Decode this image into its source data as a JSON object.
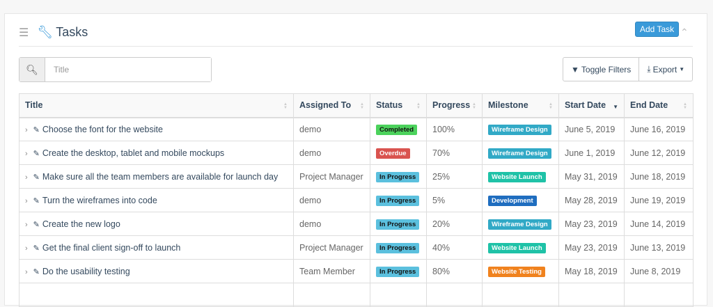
{
  "header": {
    "title": "Tasks",
    "add_label": "Add Task"
  },
  "search": {
    "placeholder": "Title"
  },
  "toolbar": {
    "toggle_filters": "Toggle Filters",
    "export": "Export"
  },
  "columns": [
    "Title",
    "Assigned To",
    "Status",
    "Progress",
    "Milestone",
    "Start Date",
    "End Date"
  ],
  "status_colors": {
    "Completed": [
      "#4cd25c",
      "#111"
    ],
    "Overdue": [
      "#d9534f",
      "#fff"
    ],
    "In Progress": [
      "#5bc0de",
      "#111"
    ]
  },
  "milestone_colors": {
    "Wireframe Design": "#31a9c6",
    "Website Launch": "#1fc2a7",
    "Development": "#1f6dbf",
    "Website Testing": "#f0821e"
  },
  "rows": [
    {
      "title": "Choose the font for the website",
      "assigned": "demo",
      "status": "Completed",
      "progress": "100%",
      "milestone": "Wireframe Design",
      "start": "June 5, 2019",
      "end": "June 16, 2019"
    },
    {
      "title": "Create the desktop, tablet and mobile mockups",
      "assigned": "demo",
      "status": "Overdue",
      "progress": "70%",
      "milestone": "Wireframe Design",
      "start": "June 1, 2019",
      "end": "June 12, 2019"
    },
    {
      "title": "Make sure all the team members are available for launch day",
      "assigned": "Project Manager",
      "status": "In Progress",
      "progress": "25%",
      "milestone": "Website Launch",
      "start": "May 31, 2019",
      "end": "June 18, 2019"
    },
    {
      "title": "Turn the wireframes into code",
      "assigned": "demo",
      "status": "In Progress",
      "progress": "5%",
      "milestone": "Development",
      "start": "May 28, 2019",
      "end": "June 19, 2019"
    },
    {
      "title": "Create the new logo",
      "assigned": "demo",
      "status": "In Progress",
      "progress": "20%",
      "milestone": "Wireframe Design",
      "start": "May 23, 2019",
      "end": "June 14, 2019"
    },
    {
      "title": "Get the final client sign-off to launch",
      "assigned": "Project Manager",
      "status": "In Progress",
      "progress": "40%",
      "milestone": "Website Launch",
      "start": "May 23, 2019",
      "end": "June 13, 2019"
    },
    {
      "title": "Do the usability testing",
      "assigned": "Team Member",
      "status": "In Progress",
      "progress": "80%",
      "milestone": "Website Testing",
      "start": "May 18, 2019",
      "end": "June 8, 2019"
    }
  ]
}
